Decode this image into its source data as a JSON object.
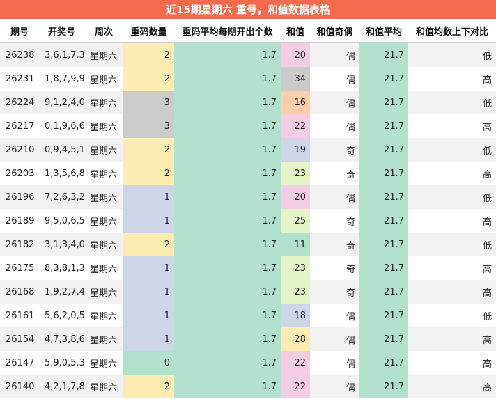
{
  "title": "近15期星期六 重号，和值数据表格",
  "headers": [
    "期号",
    "开奖号",
    "周次",
    "重码数量",
    "重码平均每期开出个数",
    "和值",
    "和值奇偶",
    "和值平均",
    "和值均数上下对比"
  ],
  "colors": {
    "repeat_0": "#b2e2cd",
    "repeat_1": "#cdd5e6",
    "repeat_2": "#fdedb3",
    "repeat_3": "#cbcbcb",
    "avg_cell": "#b2e2cd"
  },
  "rows": [
    {
      "issue": "26238",
      "numbers": "3,6,1,7,3",
      "weekday": "星期六",
      "repeat": "2",
      "repeat_avg": "1.7",
      "sum": "20",
      "parity": "偶",
      "sum_avg": "21.7",
      "compare": "低",
      "sum_color": "#f3cde4"
    },
    {
      "issue": "26231",
      "numbers": "1,8,7,9,9",
      "weekday": "星期六",
      "repeat": "2",
      "repeat_avg": "1.7",
      "sum": "34",
      "parity": "偶",
      "sum_avg": "21.7",
      "compare": "高",
      "sum_color": "#cbcbcb"
    },
    {
      "issue": "26224",
      "numbers": "9,1,2,4,0",
      "weekday": "星期六",
      "repeat": "3",
      "repeat_avg": "1.7",
      "sum": "16",
      "parity": "偶",
      "sum_avg": "21.7",
      "compare": "低",
      "sum_color": "#fdcdad"
    },
    {
      "issue": "26217",
      "numbers": "0,1,9,6,6",
      "weekday": "星期六",
      "repeat": "3",
      "repeat_avg": "1.7",
      "sum": "22",
      "parity": "偶",
      "sum_avg": "21.7",
      "compare": "高",
      "sum_color": "#f3cde4"
    },
    {
      "issue": "26210",
      "numbers": "0,9,4,5,1",
      "weekday": "星期六",
      "repeat": "2",
      "repeat_avg": "1.7",
      "sum": "19",
      "parity": "奇",
      "sum_avg": "21.7",
      "compare": "低",
      "sum_color": "#cdd5e6"
    },
    {
      "issue": "26203",
      "numbers": "1,3,5,6,8",
      "weekday": "星期六",
      "repeat": "2",
      "repeat_avg": "1.7",
      "sum": "23",
      "parity": "奇",
      "sum_avg": "21.7",
      "compare": "高",
      "sum_color": "#e5f5c9"
    },
    {
      "issue": "26196",
      "numbers": "7,2,6,3,2",
      "weekday": "星期六",
      "repeat": "1",
      "repeat_avg": "1.7",
      "sum": "20",
      "parity": "偶",
      "sum_avg": "21.7",
      "compare": "低",
      "sum_color": "#f3cde4"
    },
    {
      "issue": "26189",
      "numbers": "9,5,0,6,5",
      "weekday": "星期六",
      "repeat": "1",
      "repeat_avg": "1.7",
      "sum": "25",
      "parity": "奇",
      "sum_avg": "21.7",
      "compare": "高",
      "sum_color": "#e5f5c9"
    },
    {
      "issue": "26182",
      "numbers": "3,1,3,4,0",
      "weekday": "星期六",
      "repeat": "2",
      "repeat_avg": "1.7",
      "sum": "11",
      "parity": "奇",
      "sum_avg": "21.7",
      "compare": "低",
      "sum_color": "#b2e2cd"
    },
    {
      "issue": "26175",
      "numbers": "8,3,8,1,3",
      "weekday": "星期六",
      "repeat": "1",
      "repeat_avg": "1.7",
      "sum": "23",
      "parity": "奇",
      "sum_avg": "21.7",
      "compare": "高",
      "sum_color": "#e5f5c9"
    },
    {
      "issue": "26168",
      "numbers": "1,9,2,7,4",
      "weekday": "星期六",
      "repeat": "1",
      "repeat_avg": "1.7",
      "sum": "23",
      "parity": "奇",
      "sum_avg": "21.7",
      "compare": "高",
      "sum_color": "#e5f5c9"
    },
    {
      "issue": "26161",
      "numbers": "5,6,2,0,5",
      "weekday": "星期六",
      "repeat": "1",
      "repeat_avg": "1.7",
      "sum": "18",
      "parity": "偶",
      "sum_avg": "21.7",
      "compare": "低",
      "sum_color": "#cdd5e6"
    },
    {
      "issue": "26154",
      "numbers": "4,7,3,8,6",
      "weekday": "星期六",
      "repeat": "1",
      "repeat_avg": "1.7",
      "sum": "28",
      "parity": "偶",
      "sum_avg": "21.7",
      "compare": "高",
      "sum_color": "#fdedb3"
    },
    {
      "issue": "26147",
      "numbers": "5,9,0,5,3",
      "weekday": "星期六",
      "repeat": "0",
      "repeat_avg": "1.7",
      "sum": "22",
      "parity": "偶",
      "sum_avg": "21.7",
      "compare": "高",
      "sum_color": "#f3cde4"
    },
    {
      "issue": "26140",
      "numbers": "4,2,1,7,8",
      "weekday": "星期六",
      "repeat": "2",
      "repeat_avg": "1.7",
      "sum": "22",
      "parity": "偶",
      "sum_avg": "21.7",
      "compare": "高",
      "sum_color": "#f3cde4"
    }
  ]
}
